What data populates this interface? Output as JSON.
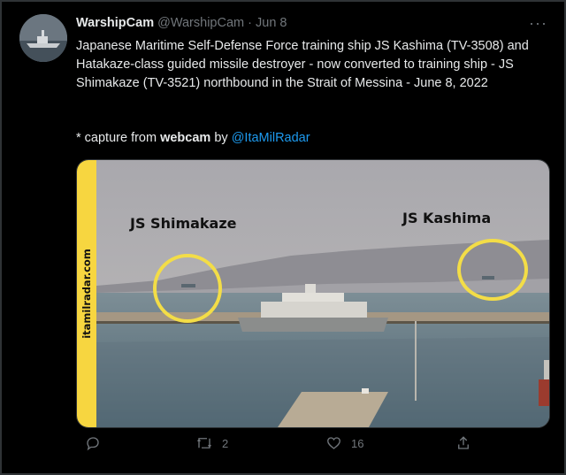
{
  "tweet": {
    "display_name": "WarshipCam",
    "handle": "@WarshipCam",
    "date": "Jun 8",
    "text": "Japanese Maritime Self-Defense Force training ship JS Kashima (TV-3508) and Hatakaze-class guided missile destroyer - now converted to training ship - JS Shimakaze (TV-3521) northbound in the Strait of Messina - June 8, 2022",
    "capture_prefix": "* capture from ",
    "capture_webcam": "webcam",
    "capture_by": " by ",
    "capture_handle": "@ItaMilRadar"
  },
  "media": {
    "watermark": "itamilradar.com",
    "label_left": "JS Shimakaze",
    "label_right": "JS Kashima",
    "highlight_color": "#f3dd47"
  },
  "actions": {
    "retweets": "2",
    "likes": "16"
  },
  "icons": [
    "more-icon",
    "reply-icon",
    "retweet-icon",
    "like-icon",
    "share-icon"
  ]
}
